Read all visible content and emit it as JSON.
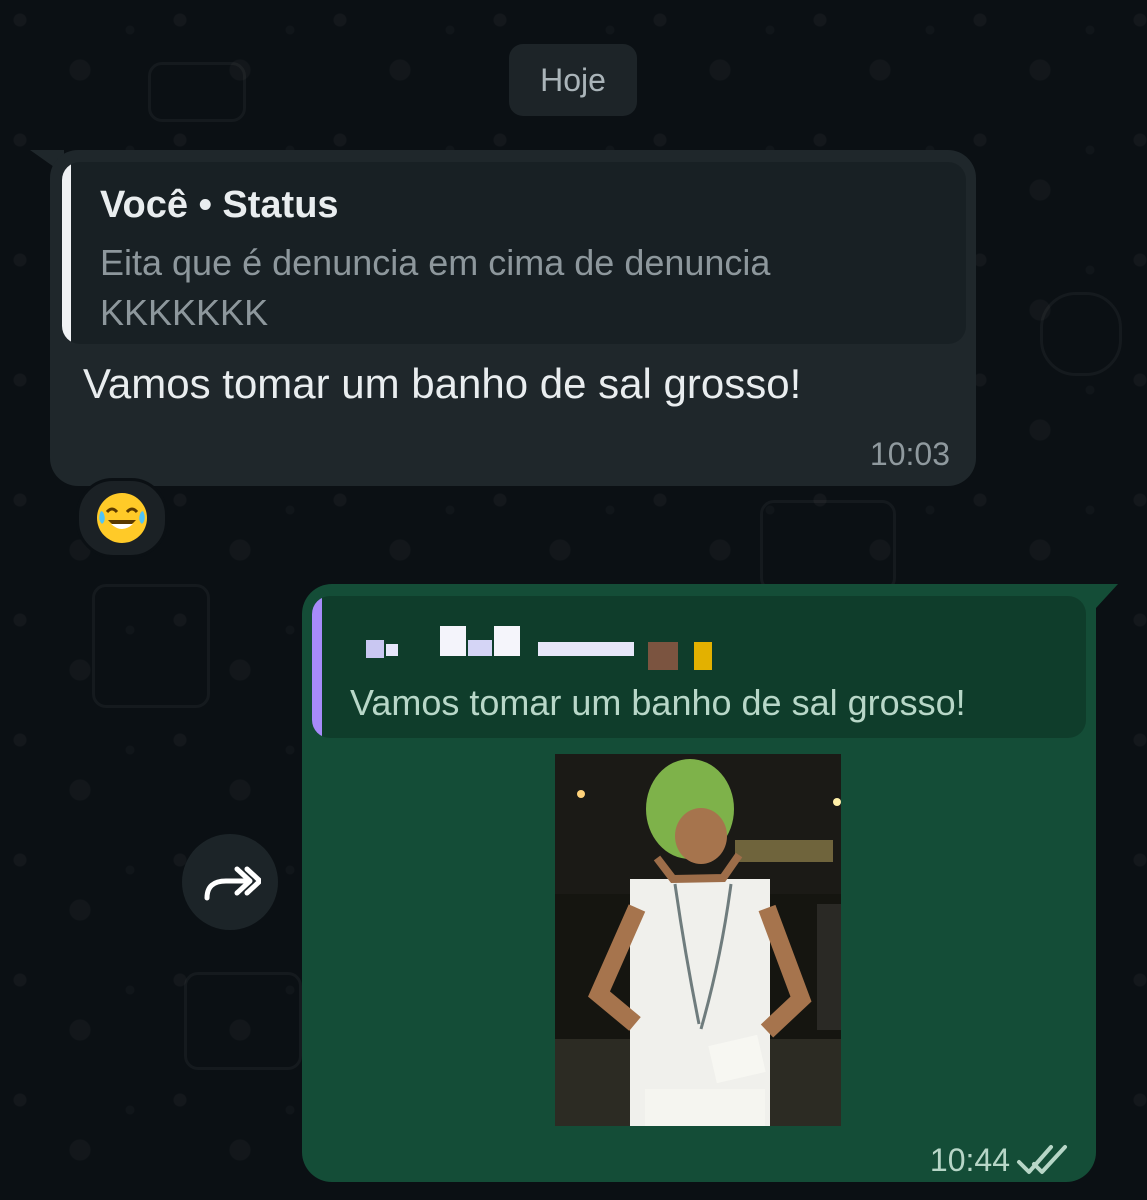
{
  "chat": {
    "date_divider": "Hoje",
    "incoming": {
      "quoted_title": "Você • Status",
      "quoted_text": "Eita que é denuncia em cima de denuncia KKKKKKK",
      "message_text": "Vamos tomar um banho de sal grosso!",
      "time": "10:03",
      "reaction_emoji": "😂"
    },
    "outgoing": {
      "reply_text": "Vamos tomar um banho de sal grosso!",
      "media_type": "GIF/video",
      "time": "10:44",
      "status": "read"
    },
    "forward_icon": "forward-arrow-icon"
  },
  "colors": {
    "background": "#0b1014",
    "incoming_bubble": "#1f272b",
    "outgoing_bubble": "#144d37",
    "reply_accent": "#a78bfa",
    "quote_accent": "#f0f2f4"
  }
}
